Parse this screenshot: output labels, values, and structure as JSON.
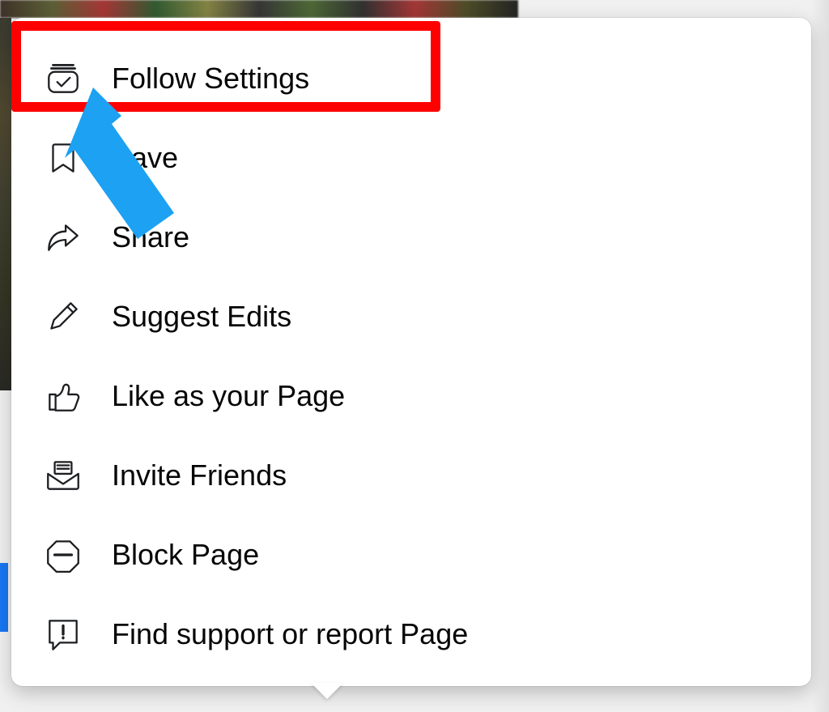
{
  "menu": {
    "items": [
      {
        "label": "Follow Settings",
        "icon": "follow-settings-icon"
      },
      {
        "label": "Save",
        "icon": "bookmark-icon"
      },
      {
        "label": "Share",
        "icon": "share-icon"
      },
      {
        "label": "Suggest Edits",
        "icon": "pencil-icon"
      },
      {
        "label": "Like as your Page",
        "icon": "thumbs-up-icon"
      },
      {
        "label": "Invite Friends",
        "icon": "invite-friends-icon"
      },
      {
        "label": "Block Page",
        "icon": "block-icon"
      },
      {
        "label": "Find support or report Page",
        "icon": "report-icon"
      }
    ]
  },
  "annotation": {
    "highlight_color": "#ff0000",
    "arrow_color": "#1da1f2"
  }
}
